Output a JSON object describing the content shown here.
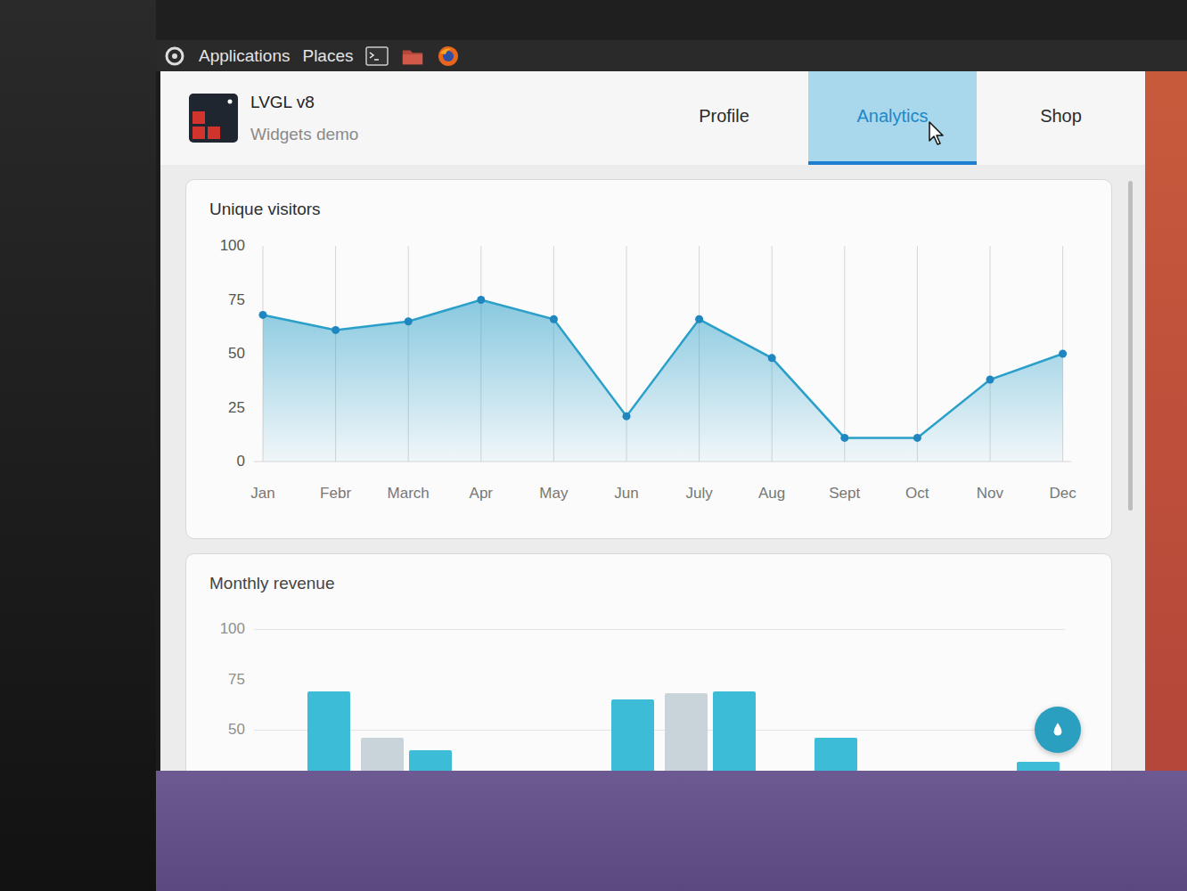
{
  "desktop_panel": {
    "menus": [
      "Applications",
      "Places"
    ]
  },
  "app": {
    "title": "LVGL v8",
    "subtitle": "Widgets demo"
  },
  "tabs": [
    {
      "label": "Profile",
      "selected": false
    },
    {
      "label": "Analytics",
      "selected": true
    },
    {
      "label": "Shop",
      "selected": false
    }
  ],
  "unique_visitors": {
    "title": "Unique visitors",
    "y_ticks": [
      "100",
      "75",
      "50",
      "25",
      "0"
    ],
    "x_labels": [
      "Jan",
      "Febr",
      "March",
      "Apr",
      "May",
      "Jun",
      "July",
      "Aug",
      "Sept",
      "Oct",
      "Nov",
      "Dec"
    ],
    "values": [
      68,
      61,
      65,
      75,
      66,
      21,
      66,
      48,
      11,
      11,
      38,
      50
    ]
  },
  "monthly_revenue": {
    "title": "Monthly revenue",
    "y_ticks": [
      "100",
      "75",
      "50"
    ],
    "series": [
      {
        "color": "#c9d3da",
        "values": [
          0,
          46,
          0,
          0,
          68,
          0,
          0,
          0
        ]
      },
      {
        "color": "#3dbcd8",
        "values": [
          69,
          40,
          0,
          65,
          69,
          46,
          0,
          34
        ]
      }
    ]
  }
}
